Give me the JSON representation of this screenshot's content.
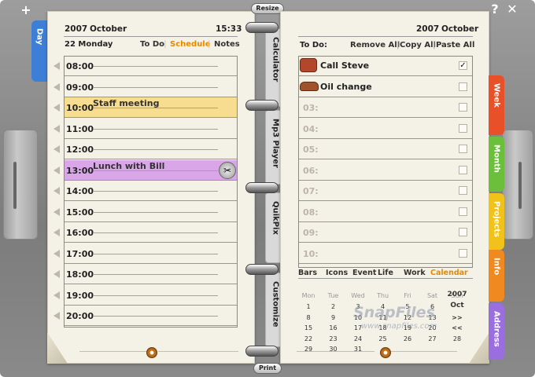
{
  "window": {
    "add_label": "+",
    "help_label": "?",
    "close_label": "✕",
    "resize_label": "Resize",
    "print_label": "Print"
  },
  "left": {
    "year": "2007",
    "month": "October",
    "time": "15:33",
    "day_label": "22 Monday",
    "tabs": [
      "To Do",
      "Schedule",
      "Notes"
    ],
    "day_tab": "Day",
    "hours": [
      {
        "time": "08:00",
        "event": ""
      },
      {
        "time": "09:00",
        "event": ""
      },
      {
        "time": "10:00",
        "event": "Staff meeting"
      },
      {
        "time": "11:00",
        "event": ""
      },
      {
        "time": "12:00",
        "event": ""
      },
      {
        "time": "13:00",
        "event": "Lunch with Bill"
      },
      {
        "time": "14:00",
        "event": ""
      },
      {
        "time": "15:00",
        "event": ""
      },
      {
        "time": "16:00",
        "event": ""
      },
      {
        "time": "17:00",
        "event": ""
      },
      {
        "time": "18:00",
        "event": ""
      },
      {
        "time": "19:00",
        "event": ""
      },
      {
        "time": "20:00",
        "event": ""
      }
    ]
  },
  "spine": {
    "tabs": [
      "Calculator",
      "Mp3 Player",
      "QuikPix",
      "Customize"
    ]
  },
  "right": {
    "year": "2007",
    "month": "October",
    "todo_label": "To Do:",
    "actions": [
      "Remove All",
      "Copy All",
      "Paste All"
    ],
    "todos": [
      {
        "num": "",
        "text": "Call Steve",
        "checked": "✓",
        "icon": "phone-icon"
      },
      {
        "num": "",
        "text": "Oil change",
        "checked": "",
        "icon": "car-icon"
      },
      {
        "num": "03:",
        "text": "",
        "checked": ""
      },
      {
        "num": "04:",
        "text": "",
        "checked": ""
      },
      {
        "num": "05:",
        "text": "",
        "checked": ""
      },
      {
        "num": "06:",
        "text": "",
        "checked": ""
      },
      {
        "num": "07:",
        "text": "",
        "checked": ""
      },
      {
        "num": "08:",
        "text": "",
        "checked": ""
      },
      {
        "num": "09:",
        "text": "",
        "checked": ""
      },
      {
        "num": "10:",
        "text": "",
        "checked": ""
      }
    ],
    "footer_tabs": [
      "Bars",
      "Icons",
      "Event",
      "Life",
      "Work",
      "Calendar"
    ],
    "calendar": {
      "weekdays": [
        "Mon",
        "Tue",
        "Wed",
        "Thu",
        "Fri",
        "Sat",
        "Sun"
      ],
      "year": "2007",
      "month": "Oct",
      "nav_next": ">>",
      "nav_prev": "<<",
      "weeks": [
        [
          "1",
          "2",
          "3",
          "4",
          "5",
          "6",
          "7"
        ],
        [
          "8",
          "9",
          "10",
          "11",
          "12",
          "13",
          "14"
        ],
        [
          "15",
          "16",
          "17",
          "18",
          "19",
          "20",
          "21"
        ],
        [
          "22",
          "23",
          "24",
          "25",
          "26",
          "27",
          "28"
        ],
        [
          "29",
          "30",
          "31",
          "",
          "",
          "",
          ""
        ]
      ]
    },
    "side_tabs": [
      {
        "label": "Week",
        "color": "#e8502a"
      },
      {
        "label": "Month",
        "color": "#6bbf3a"
      },
      {
        "label": "Projects",
        "color": "#f0c21a"
      },
      {
        "label": "Info",
        "color": "#f08a20"
      },
      {
        "label": "Address",
        "color": "#9b6ee0"
      }
    ]
  },
  "watermark": "SnapFiles",
  "watermark_url": "www.snapfiles.com",
  "colors": {
    "accent": "#e58a00",
    "meeting": "#f7dd8f",
    "lunch": "#d9a6e8"
  }
}
